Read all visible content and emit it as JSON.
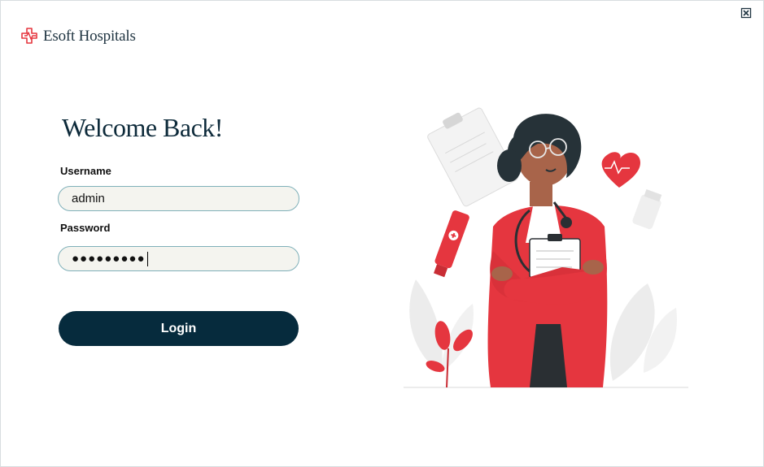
{
  "app": {
    "name": "Esoft Hospitals"
  },
  "login": {
    "heading": "Welcome Back!",
    "username_label": "Username",
    "username_value": "admin",
    "password_label": "Password",
    "password_value": "●●●●●●●●●",
    "button_label": "Login"
  },
  "colors": {
    "brand_dark": "#062b3d",
    "accent_red": "#e5363f",
    "field_border": "#7fb0b9",
    "field_bg": "#f4f4ef"
  },
  "icons": {
    "close": "close-icon",
    "logo": "medical-cross-logo",
    "illustration": "doctor-illustration"
  }
}
